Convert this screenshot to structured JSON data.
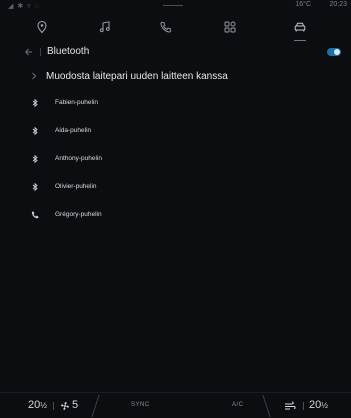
{
  "status_bar": {
    "left_indicators": "◢ ✱ ▿ ◌",
    "outside_temperature": "16°C",
    "time": "20:23"
  },
  "tabs": [
    {
      "icon": "navigation-pin-icon",
      "active": false
    },
    {
      "icon": "music-note-icon",
      "active": false
    },
    {
      "icon": "phone-icon",
      "active": false
    },
    {
      "icon": "apps-grid-icon",
      "active": false
    },
    {
      "icon": "car-icon",
      "active": true
    }
  ],
  "header": {
    "title": "Bluetooth",
    "toggle_on": true
  },
  "pair_new": {
    "label": "Muodosta laitepari uuden laitteen kanssa"
  },
  "devices": [
    {
      "name": "Fabien-puhelin",
      "icon": "bluetooth-icon"
    },
    {
      "name": "Aida-puhelin",
      "icon": "bluetooth-icon"
    },
    {
      "name": "Anthony-puhelin",
      "icon": "bluetooth-icon"
    },
    {
      "name": "Olivier-puhelin",
      "icon": "bluetooth-icon"
    },
    {
      "name": "Grégory-puhelin",
      "icon": "phone-icon"
    }
  ],
  "climate": {
    "left_temp": "20",
    "left_temp_half": "½",
    "fan_level": "5",
    "sync_label": "SYNC",
    "ac_label": "A/C",
    "right_temp": "20",
    "right_temp_half": "½"
  },
  "colors": {
    "background": "#0c0d10",
    "accent": "#1c6fa8",
    "text": "#e4e6ea",
    "muted": "#8b9098"
  }
}
